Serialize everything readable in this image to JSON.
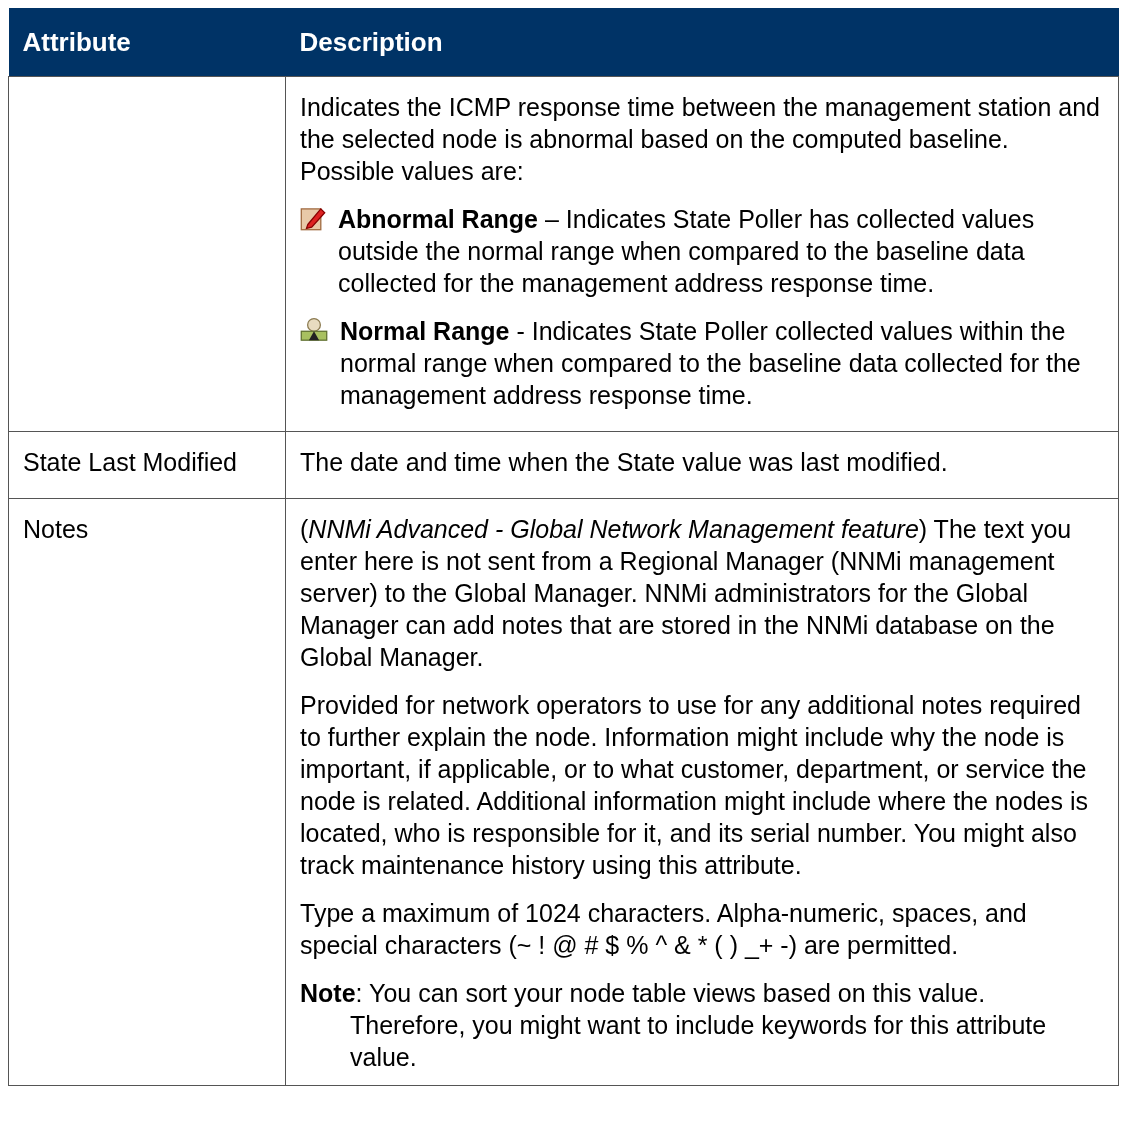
{
  "table": {
    "columns": [
      "Attribute",
      "Description"
    ],
    "rows": [
      {
        "attribute": "",
        "paragraphs": [
          {
            "kind": "text",
            "text": "Indicates the ICMP response time between the management station and the selected node is abnormal based on the computed baseline. Possible values are:"
          },
          {
            "kind": "item",
            "text": "**Abnormal Range** – Indicates State Poller has collected values outside the normal range when compared to the baseline data collected for the management address response time."
          },
          {
            "kind": "item",
            "text": "**Normal Range** - Indicates State Poller collected values within the normal range when compared to the baseline data collected for the management address response time."
          }
        ]
      },
      {
        "attribute": "State Last Modified",
        "paragraphs": [
          {
            "kind": "text",
            "text": "The date and time when the State value was last modified."
          }
        ]
      },
      {
        "attribute": "Notes",
        "paragraphs": [
          {
            "kind": "text",
            "text": "(*NNMi Advanced - Global Network Management feature*) The text you enter here is not sent from a Regional Manager (NNMi management server) to the Global Manager. NNMi administrators for the Global Manager can add notes that are stored in the NNMi database on the Global Manager."
          },
          {
            "kind": "text",
            "text": "Provided for network operators to use for any additional notes required to further explain the node. Information might include why the node is important, if applicable, or to what customer, department, or service the node is related. Additional information might include where the nodes is located, who is responsible for it, and its serial number. You might also track maintenance history using this attribute."
          },
          {
            "kind": "text",
            "text": "Type a maximum of 1024 characters. Alpha-numeric, spaces, and special characters (~ ! @ # $ % ^ & * ( ) _+ -) are permitted."
          },
          {
            "kind": "note",
            "text": "**Note**: You can sort your node table views based on this value. Therefore, you might want to include keywords for this attribute value."
          }
        ]
      }
    ]
  }
}
